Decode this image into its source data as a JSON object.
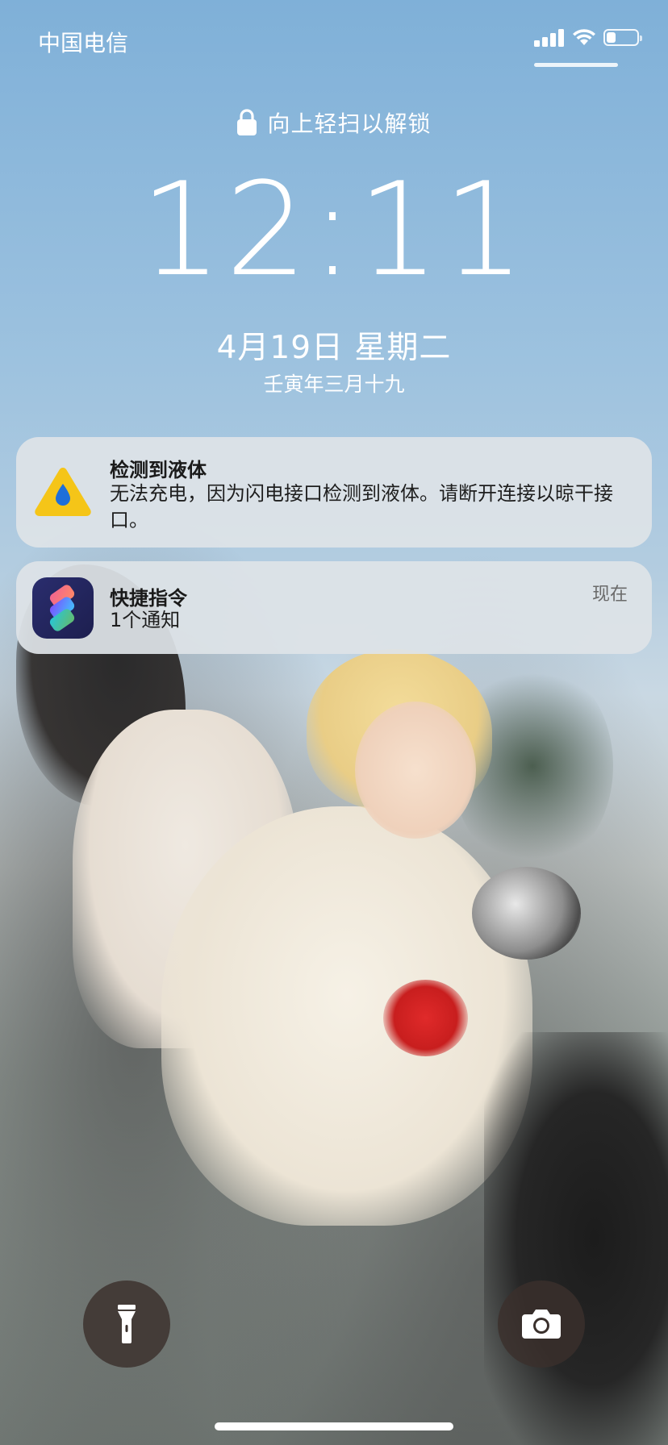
{
  "status_bar": {
    "carrier": "中国电信",
    "signal_bars": 4,
    "battery_level": 0.3,
    "icons": [
      "signal-icon",
      "wifi-icon",
      "battery-icon"
    ]
  },
  "lock_screen": {
    "unlock_hint": "向上轻扫以解锁",
    "time": "12:11",
    "date": "4月19日 星期二",
    "lunar_date": "壬寅年三月十九"
  },
  "notifications": [
    {
      "title": "检测到液体",
      "body": "无法充电，因为闪电接口检测到液体。请断开连接以晾干接口。",
      "time": "",
      "icon": "liquid-warning-icon"
    },
    {
      "title": "快捷指令",
      "body": "1个通知",
      "time": "现在",
      "icon": "shortcuts-icon"
    }
  ],
  "bottom_controls": {
    "left": "flashlight-icon",
    "right": "camera-icon"
  },
  "colors": {
    "notification_bg": "#dee3e7",
    "warning_yellow": "#f5c518",
    "drop_blue": "#1e6fd9",
    "control_bg": "#3a302c"
  }
}
